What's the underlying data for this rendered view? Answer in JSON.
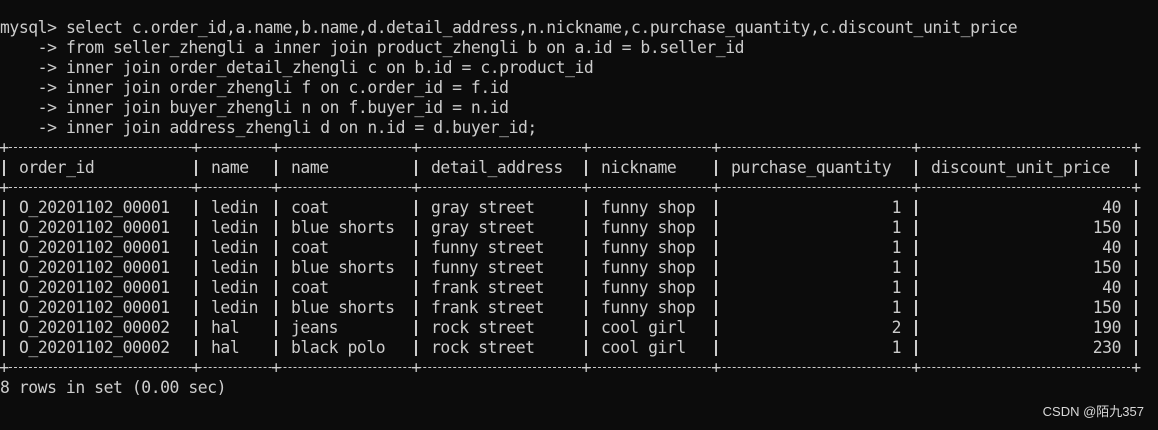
{
  "terminal": {
    "prompt": "mysql>",
    "continuation": "    ->",
    "query_lines": [
      "select c.order_id,a.name,b.name,d.detail_address,n.nickname,c.purchase_quantity,c.discount_unit_price",
      "from seller_zhengli a inner join product_zhengli b on a.id = b.seller_id",
      "inner join order_detail_zhengli c on b.id = c.product_id",
      "inner join order_zhengli f on c.order_id = f.id",
      "inner join buyer_zhengli n on f.buyer_id = n.id",
      "inner join address_zhengli d on n.id = d.buyer_id;"
    ]
  },
  "result": {
    "columns": [
      "order_id",
      "name",
      "name",
      "detail_address",
      "nickname",
      "purchase_quantity",
      "discount_unit_price"
    ],
    "rows": [
      [
        "O_20201102_00001",
        "ledin",
        "coat",
        "gray street",
        "funny shop",
        "1",
        "40"
      ],
      [
        "O_20201102_00001",
        "ledin",
        "blue shorts",
        "gray street",
        "funny shop",
        "1",
        "150"
      ],
      [
        "O_20201102_00001",
        "ledin",
        "coat",
        "funny street",
        "funny shop",
        "1",
        "40"
      ],
      [
        "O_20201102_00001",
        "ledin",
        "blue shorts",
        "funny street",
        "funny shop",
        "1",
        "150"
      ],
      [
        "O_20201102_00001",
        "ledin",
        "coat",
        "frank street",
        "funny shop",
        "1",
        "40"
      ],
      [
        "O_20201102_00001",
        "ledin",
        "blue shorts",
        "frank street",
        "funny shop",
        "1",
        "150"
      ],
      [
        "O_20201102_00002",
        "hal",
        "jeans",
        "rock street",
        "cool girl",
        "2",
        "190"
      ],
      [
        "O_20201102_00002",
        "hal",
        "black polo",
        "rock street",
        "cool girl",
        "1",
        "230"
      ]
    ],
    "summary": "8 rows in set (0.00 sec)"
  },
  "watermark": "CSDN @陌九357",
  "colors": {
    "background": "#0c0c0c",
    "text": "#cccccc"
  }
}
